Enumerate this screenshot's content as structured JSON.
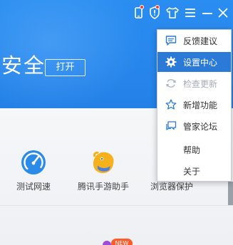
{
  "header": {
    "title_partial": "安全",
    "open_button": "打开"
  },
  "titlebar": {
    "icons": [
      "phone-icon",
      "shield-icon",
      "skin-icon",
      "menu-icon",
      "minimize-icon",
      "close-icon"
    ]
  },
  "tools": [
    {
      "label": "测试网速",
      "icon": "speed-test-icon"
    },
    {
      "label": "腾讯手游助手",
      "icon": "mobile-game-assistant-icon"
    },
    {
      "label": "浏览器保护",
      "icon": "browser-protection-icon"
    }
  ],
  "badge": {
    "new_label": "NEW"
  },
  "menu": {
    "items": [
      {
        "label": "反馈建议",
        "icon": "feedback-icon",
        "state": "normal"
      },
      {
        "label": "设置中心",
        "icon": "settings-gear-icon",
        "state": "active"
      },
      {
        "label": "检查更新",
        "icon": "refresh-icon",
        "state": "disabled"
      },
      {
        "label": "新增功能",
        "icon": "star-icon",
        "state": "normal"
      },
      {
        "label": "管家论坛",
        "icon": "forum-icon",
        "state": "normal"
      },
      {
        "label": "帮助",
        "icon": "",
        "state": "normal"
      },
      {
        "label": "关于",
        "icon": "",
        "state": "normal"
      }
    ]
  },
  "colors": {
    "header_blue": "#2786ec",
    "menu_active": "#2b7ad8",
    "accent_icon": "#2b7ad8"
  }
}
